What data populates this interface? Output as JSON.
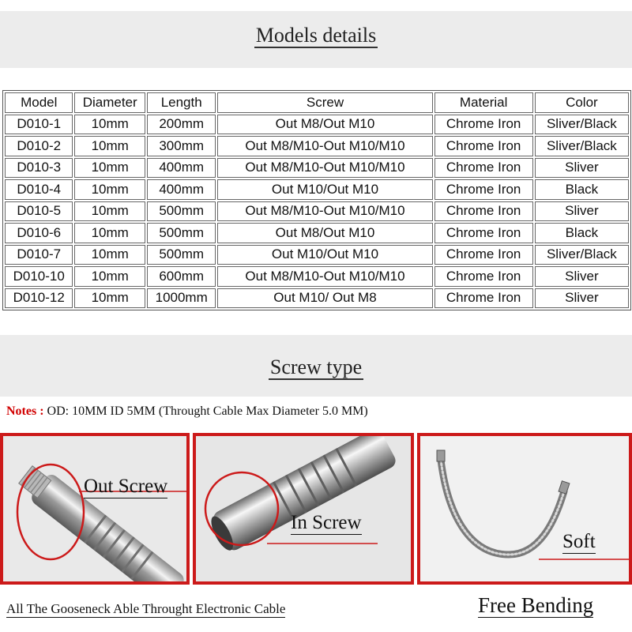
{
  "sections": {
    "models_title": "Models details",
    "screw_title": "Screw type"
  },
  "table": {
    "headers": [
      "Model",
      "Diameter",
      "Length",
      "Screw",
      "Material",
      "Color"
    ],
    "rows": [
      [
        "D010-1",
        "10mm",
        "200mm",
        "Out M8/Out M10",
        "Chrome Iron",
        "Sliver/Black"
      ],
      [
        "D010-2",
        "10mm",
        "300mm",
        "Out M8/M10-Out M10/M10",
        "Chrome Iron",
        "Sliver/Black"
      ],
      [
        "D010-3",
        "10mm",
        "400mm",
        "Out M8/M10-Out M10/M10",
        "Chrome Iron",
        "Sliver"
      ],
      [
        "D010-4",
        "10mm",
        "400mm",
        "Out M10/Out M10",
        "Chrome Iron",
        "Black"
      ],
      [
        "D010-5",
        "10mm",
        "500mm",
        "Out M8/M10-Out M10/M10",
        "Chrome Iron",
        "Sliver"
      ],
      [
        "D010-6",
        "10mm",
        "500mm",
        "Out M8/Out M10",
        "Chrome Iron",
        "Black"
      ],
      [
        "D010-7",
        "10mm",
        "500mm",
        "Out M10/Out M10",
        "Chrome Iron",
        "Sliver/Black"
      ],
      [
        "D010-10",
        "10mm",
        "600mm",
        "Out M8/M10-Out M10/M10",
        "Chrome Iron",
        "Sliver"
      ],
      [
        "D010-12",
        "10mm",
        "1000mm",
        "Out M10/ Out M8",
        "Chrome Iron",
        "Sliver"
      ]
    ]
  },
  "notes": {
    "label": "Notes :",
    "text": "OD: 10MM ID 5MM (Throught Cable Max Diameter  5.0 MM)"
  },
  "panels": [
    {
      "label": "Out Screw"
    },
    {
      "label": "In Screw"
    },
    {
      "label": "Soft"
    }
  ],
  "footer": {
    "left": "All The Gooseneck Able Throught Electronic Cable",
    "right": "Free Bending"
  },
  "colors": {
    "accent_red": "#cc1a1a",
    "notes_red": "#d10000",
    "band_gray": "#ececec"
  }
}
